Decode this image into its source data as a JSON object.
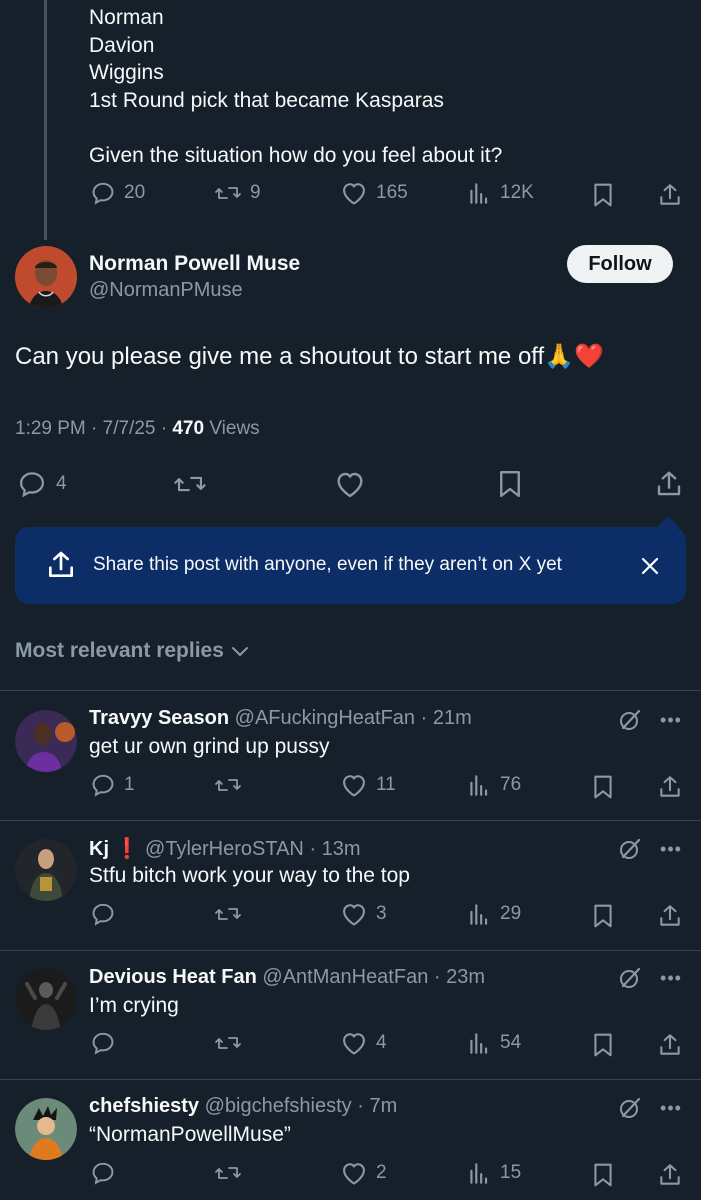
{
  "previous_post": {
    "lines": [
      "Norman",
      "Davion",
      "Wiggins",
      "1st Round pick that became Kasparas",
      "",
      "Given the situation how do you feel about it?"
    ],
    "replies": "20",
    "reposts": "9",
    "likes": "165",
    "views": "12K"
  },
  "main_post": {
    "author_name": "Norman Powell Muse",
    "author_handle": "@NormanPMuse",
    "follow_label": "Follow",
    "text": "Can you please give me a shoutout to start me off🙏❤️",
    "time": "1:29 PM · 7/7/25 · ",
    "views_count": "470",
    "views_label": " Views",
    "replies": "4"
  },
  "share_banner": {
    "text": "Share this post with anyone, even if they aren’t on X yet"
  },
  "sort": {
    "label": "Most relevant replies"
  },
  "replies": [
    {
      "name": "Travyy Season",
      "badge": "",
      "handle": "@AFuckingHeatFan",
      "time": "· 21m",
      "text": "get ur own grind up pussy",
      "replies": "1",
      "reposts": "",
      "likes": "11",
      "views": "76"
    },
    {
      "name": "Kj",
      "badge": "❗",
      "handle": "@TylerHeroSTAN",
      "time": "· 13m",
      "text": "Stfu bitch work your way to the top",
      "replies": "",
      "reposts": "",
      "likes": "3",
      "views": "29"
    },
    {
      "name": "Devious Heat Fan",
      "badge": "",
      "handle": "@AntManHeatFan",
      "time": "· 23m",
      "text": "I’m crying",
      "replies": "",
      "reposts": "",
      "likes": "4",
      "views": "54"
    },
    {
      "name": "chefshiesty",
      "badge": "",
      "handle": "@bigchefshiesty",
      "time": "· 7m",
      "text": "“NormanPowellMuse”",
      "replies": "",
      "reposts": "",
      "likes": "2",
      "views": "15"
    }
  ],
  "colors": {
    "background": "#15202b",
    "muted": "#8b98a5",
    "banner": "#0d2d66",
    "badge_red": "#e0245e"
  }
}
